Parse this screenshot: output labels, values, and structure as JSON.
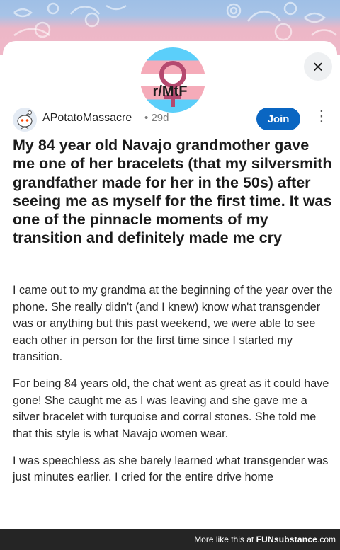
{
  "banner": {
    "colors": [
      "#a7c3e7",
      "#f0b8c8"
    ]
  },
  "subreddit": {
    "name": "r/MtF",
    "icon": "transgender-flag-female-symbol-icon"
  },
  "close_button": {
    "label": "×",
    "icon": "close-icon"
  },
  "post": {
    "username": "APotatoMassacre",
    "separator": "•",
    "age": "29d",
    "join_label": "Join",
    "more_label": "⋮",
    "title": "My 84 year old Navajo grandmother gave me one of her bracelets (that my silversmith grandfather made for her in the 50s) after seeing me as myself for the first time. It was one of the pinnacle moments of my transition and definitely made me cry",
    "body": [
      "I came out to my grandma at the beginning of the year over the phone. She really didn't (and I knew) know what transgender was or anything but this past weekend, we were able to see each other in person for the first time since I started my transition.",
      "For being 84 years old, the chat went as great as it could have gone! She caught me as I was leaving and she gave me a silver bracelet with turquoise and corral stones. She told me that this style is what Navajo women wear.",
      "I was speechless as she barely learned what transgender was just minutes earlier. I cried for the entire drive home"
    ]
  },
  "footer": {
    "prefix": "More like this at ",
    "brand": "FUNsubstance",
    "suffix": ".com"
  },
  "colors": {
    "join_button": "#0a66c2",
    "footer_bg": "#252525",
    "flag_blue": "#5bcffa",
    "flag_pink": "#f5abb9",
    "symbol": "#b5496f"
  }
}
